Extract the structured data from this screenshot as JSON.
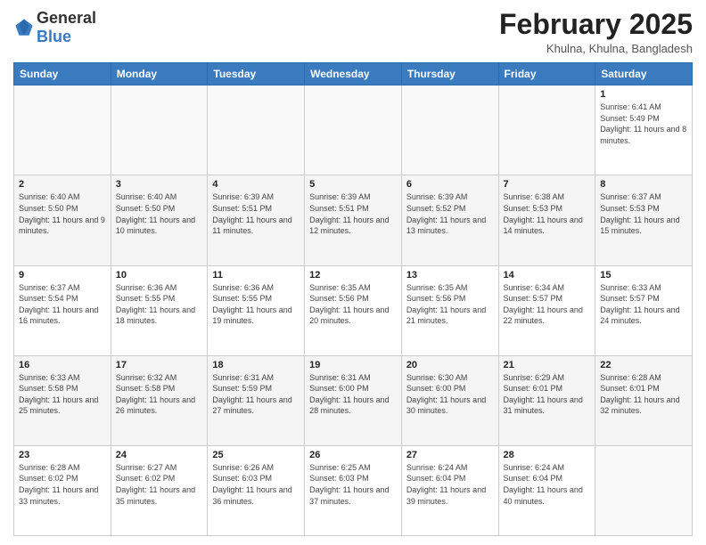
{
  "logo": {
    "general": "General",
    "blue": "Blue"
  },
  "header": {
    "month_year": "February 2025",
    "location": "Khulna, Khulna, Bangladesh"
  },
  "weekdays": [
    "Sunday",
    "Monday",
    "Tuesday",
    "Wednesday",
    "Thursday",
    "Friday",
    "Saturday"
  ],
  "weeks": [
    [
      {
        "day": "",
        "info": ""
      },
      {
        "day": "",
        "info": ""
      },
      {
        "day": "",
        "info": ""
      },
      {
        "day": "",
        "info": ""
      },
      {
        "day": "",
        "info": ""
      },
      {
        "day": "",
        "info": ""
      },
      {
        "day": "1",
        "info": "Sunrise: 6:41 AM\nSunset: 5:49 PM\nDaylight: 11 hours and 8 minutes."
      }
    ],
    [
      {
        "day": "2",
        "info": "Sunrise: 6:40 AM\nSunset: 5:50 PM\nDaylight: 11 hours and 9 minutes."
      },
      {
        "day": "3",
        "info": "Sunrise: 6:40 AM\nSunset: 5:50 PM\nDaylight: 11 hours and 10 minutes."
      },
      {
        "day": "4",
        "info": "Sunrise: 6:39 AM\nSunset: 5:51 PM\nDaylight: 11 hours and 11 minutes."
      },
      {
        "day": "5",
        "info": "Sunrise: 6:39 AM\nSunset: 5:51 PM\nDaylight: 11 hours and 12 minutes."
      },
      {
        "day": "6",
        "info": "Sunrise: 6:39 AM\nSunset: 5:52 PM\nDaylight: 11 hours and 13 minutes."
      },
      {
        "day": "7",
        "info": "Sunrise: 6:38 AM\nSunset: 5:53 PM\nDaylight: 11 hours and 14 minutes."
      },
      {
        "day": "8",
        "info": "Sunrise: 6:37 AM\nSunset: 5:53 PM\nDaylight: 11 hours and 15 minutes."
      }
    ],
    [
      {
        "day": "9",
        "info": "Sunrise: 6:37 AM\nSunset: 5:54 PM\nDaylight: 11 hours and 16 minutes."
      },
      {
        "day": "10",
        "info": "Sunrise: 6:36 AM\nSunset: 5:55 PM\nDaylight: 11 hours and 18 minutes."
      },
      {
        "day": "11",
        "info": "Sunrise: 6:36 AM\nSunset: 5:55 PM\nDaylight: 11 hours and 19 minutes."
      },
      {
        "day": "12",
        "info": "Sunrise: 6:35 AM\nSunset: 5:56 PM\nDaylight: 11 hours and 20 minutes."
      },
      {
        "day": "13",
        "info": "Sunrise: 6:35 AM\nSunset: 5:56 PM\nDaylight: 11 hours and 21 minutes."
      },
      {
        "day": "14",
        "info": "Sunrise: 6:34 AM\nSunset: 5:57 PM\nDaylight: 11 hours and 22 minutes."
      },
      {
        "day": "15",
        "info": "Sunrise: 6:33 AM\nSunset: 5:57 PM\nDaylight: 11 hours and 24 minutes."
      }
    ],
    [
      {
        "day": "16",
        "info": "Sunrise: 6:33 AM\nSunset: 5:58 PM\nDaylight: 11 hours and 25 minutes."
      },
      {
        "day": "17",
        "info": "Sunrise: 6:32 AM\nSunset: 5:58 PM\nDaylight: 11 hours and 26 minutes."
      },
      {
        "day": "18",
        "info": "Sunrise: 6:31 AM\nSunset: 5:59 PM\nDaylight: 11 hours and 27 minutes."
      },
      {
        "day": "19",
        "info": "Sunrise: 6:31 AM\nSunset: 6:00 PM\nDaylight: 11 hours and 28 minutes."
      },
      {
        "day": "20",
        "info": "Sunrise: 6:30 AM\nSunset: 6:00 PM\nDaylight: 11 hours and 30 minutes."
      },
      {
        "day": "21",
        "info": "Sunrise: 6:29 AM\nSunset: 6:01 PM\nDaylight: 11 hours and 31 minutes."
      },
      {
        "day": "22",
        "info": "Sunrise: 6:28 AM\nSunset: 6:01 PM\nDaylight: 11 hours and 32 minutes."
      }
    ],
    [
      {
        "day": "23",
        "info": "Sunrise: 6:28 AM\nSunset: 6:02 PM\nDaylight: 11 hours and 33 minutes."
      },
      {
        "day": "24",
        "info": "Sunrise: 6:27 AM\nSunset: 6:02 PM\nDaylight: 11 hours and 35 minutes."
      },
      {
        "day": "25",
        "info": "Sunrise: 6:26 AM\nSunset: 6:03 PM\nDaylight: 11 hours and 36 minutes."
      },
      {
        "day": "26",
        "info": "Sunrise: 6:25 AM\nSunset: 6:03 PM\nDaylight: 11 hours and 37 minutes."
      },
      {
        "day": "27",
        "info": "Sunrise: 6:24 AM\nSunset: 6:04 PM\nDaylight: 11 hours and 39 minutes."
      },
      {
        "day": "28",
        "info": "Sunrise: 6:24 AM\nSunset: 6:04 PM\nDaylight: 11 hours and 40 minutes."
      },
      {
        "day": "",
        "info": ""
      }
    ]
  ]
}
